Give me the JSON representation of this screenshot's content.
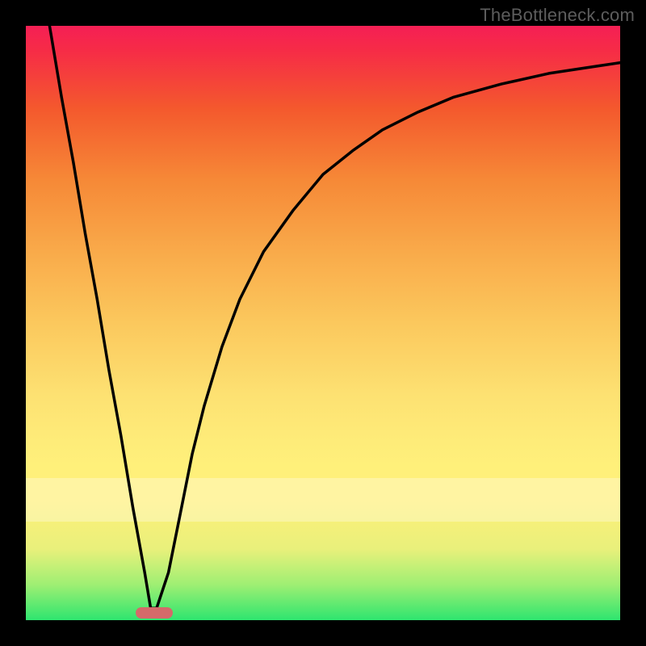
{
  "watermark": "TheBottleneck.com",
  "colors": {
    "background": "#000000",
    "gradient_top": "#f51f55",
    "gradient_mid": "#fff07a",
    "gradient_bottom": "#2ee56f",
    "curve": "#000000",
    "marker": "#d46a6a",
    "white_band": "rgba(255,255,255,0.30)"
  },
  "chart_data": {
    "type": "line",
    "title": "",
    "xlabel": "",
    "ylabel": "",
    "xlim": [
      0,
      100
    ],
    "ylim": [
      0,
      100
    ],
    "marker": {
      "x_center": 21.5,
      "width": 6,
      "y": 0
    },
    "series": [
      {
        "name": "curve",
        "x": [
          4,
          6,
          8,
          10,
          12,
          14,
          16,
          18,
          20,
          21,
          22,
          24,
          26,
          28,
          30,
          33,
          36,
          40,
          45,
          50,
          55,
          60,
          66,
          72,
          80,
          88,
          96,
          100
        ],
        "y": [
          100,
          88,
          77,
          65,
          54,
          42,
          31,
          19,
          8,
          2,
          2,
          8,
          18,
          28,
          36,
          46,
          54,
          62,
          69,
          75,
          79,
          82.5,
          85.5,
          88,
          90.2,
          92,
          93.2,
          93.8
        ]
      }
    ],
    "gradient_stops": [
      {
        "pos": 0,
        "color": "#2ee56f"
      },
      {
        "pos": 12,
        "color": "#e9f07b"
      },
      {
        "pos": 26,
        "color": "#fff07a"
      },
      {
        "pos": 50,
        "color": "#fbc85d"
      },
      {
        "pos": 74,
        "color": "#f68937"
      },
      {
        "pos": 96,
        "color": "#f62b47"
      },
      {
        "pos": 100,
        "color": "#f51f55"
      }
    ],
    "white_band": {
      "y_from": 18,
      "y_to": 25
    }
  }
}
